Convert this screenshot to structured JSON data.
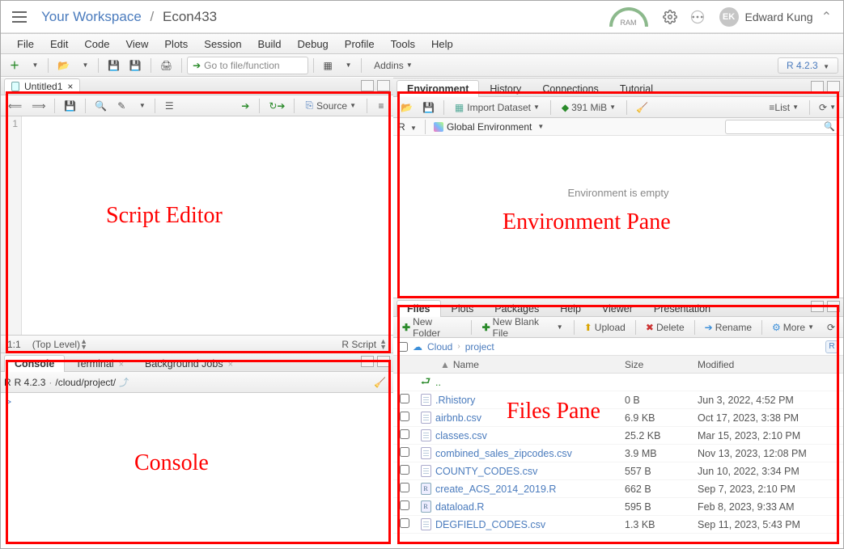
{
  "header": {
    "workspace": "Your Workspace",
    "project": "Econ433",
    "ram_label": "RAM",
    "user_initials": "EK",
    "user_name": "Edward Kung"
  },
  "menu": [
    "File",
    "Edit",
    "Code",
    "View",
    "Plots",
    "Session",
    "Build",
    "Debug",
    "Profile",
    "Tools",
    "Help"
  ],
  "toolbar": {
    "goto_placeholder": "Go to file/function",
    "addins": "Addins",
    "project_version": "R 4.2.3"
  },
  "source": {
    "tab_title": "Untitled1",
    "line1": "1",
    "source_btn": "Source",
    "status_pos": "1:1",
    "status_scope": "(Top Level)",
    "status_lang": "R Script"
  },
  "console": {
    "tabs": [
      "Console",
      "Terminal",
      "Background Jobs"
    ],
    "version": "R 4.2.3",
    "dot": "·",
    "path": "/cloud/project/",
    "prompt": ">"
  },
  "env": {
    "tabs": [
      "Environment",
      "History",
      "Connections",
      "Tutorial"
    ],
    "import": "Import Dataset",
    "mem": "391 MiB",
    "list": "List",
    "lang": "R",
    "scope": "Global Environment",
    "empty": "Environment is empty"
  },
  "files": {
    "tabs": [
      "Files",
      "Plots",
      "Packages",
      "Help",
      "Viewer",
      "Presentation"
    ],
    "btn_newfolder": "New Folder",
    "btn_newblank": "New Blank File",
    "btn_upload": "Upload",
    "btn_delete": "Delete",
    "btn_rename": "Rename",
    "btn_more": "More",
    "bread_root": "Cloud",
    "bread_proj": "project",
    "col_name": "Name",
    "col_size": "Size",
    "col_mod": "Modified",
    "up": "..",
    "rows": [
      {
        "name": ".Rhistory",
        "size": "0 B",
        "mod": "Jun 3, 2022, 4:52 PM",
        "t": "doc"
      },
      {
        "name": "airbnb.csv",
        "size": "6.9 KB",
        "mod": "Oct 17, 2023, 3:38 PM",
        "t": "doc"
      },
      {
        "name": "classes.csv",
        "size": "25.2 KB",
        "mod": "Mar 15, 2023, 2:10 PM",
        "t": "doc"
      },
      {
        "name": "combined_sales_zipcodes.csv",
        "size": "3.9 MB",
        "mod": "Nov 13, 2023, 12:08 PM",
        "t": "doc"
      },
      {
        "name": "COUNTY_CODES.csv",
        "size": "557 B",
        "mod": "Jun 10, 2022, 3:34 PM",
        "t": "doc"
      },
      {
        "name": "create_ACS_2014_2019.R",
        "size": "662 B",
        "mod": "Sep 7, 2023, 2:10 PM",
        "t": "r"
      },
      {
        "name": "dataload.R",
        "size": "595 B",
        "mod": "Feb 8, 2023, 9:33 AM",
        "t": "r"
      },
      {
        "name": "DEGFIELD_CODES.csv",
        "size": "1.3 KB",
        "mod": "Sep 11, 2023, 5:43 PM",
        "t": "doc"
      }
    ]
  },
  "annotations": {
    "script": "Script Editor",
    "env": "Environment Pane",
    "console": "Console",
    "files": "Files Pane"
  }
}
